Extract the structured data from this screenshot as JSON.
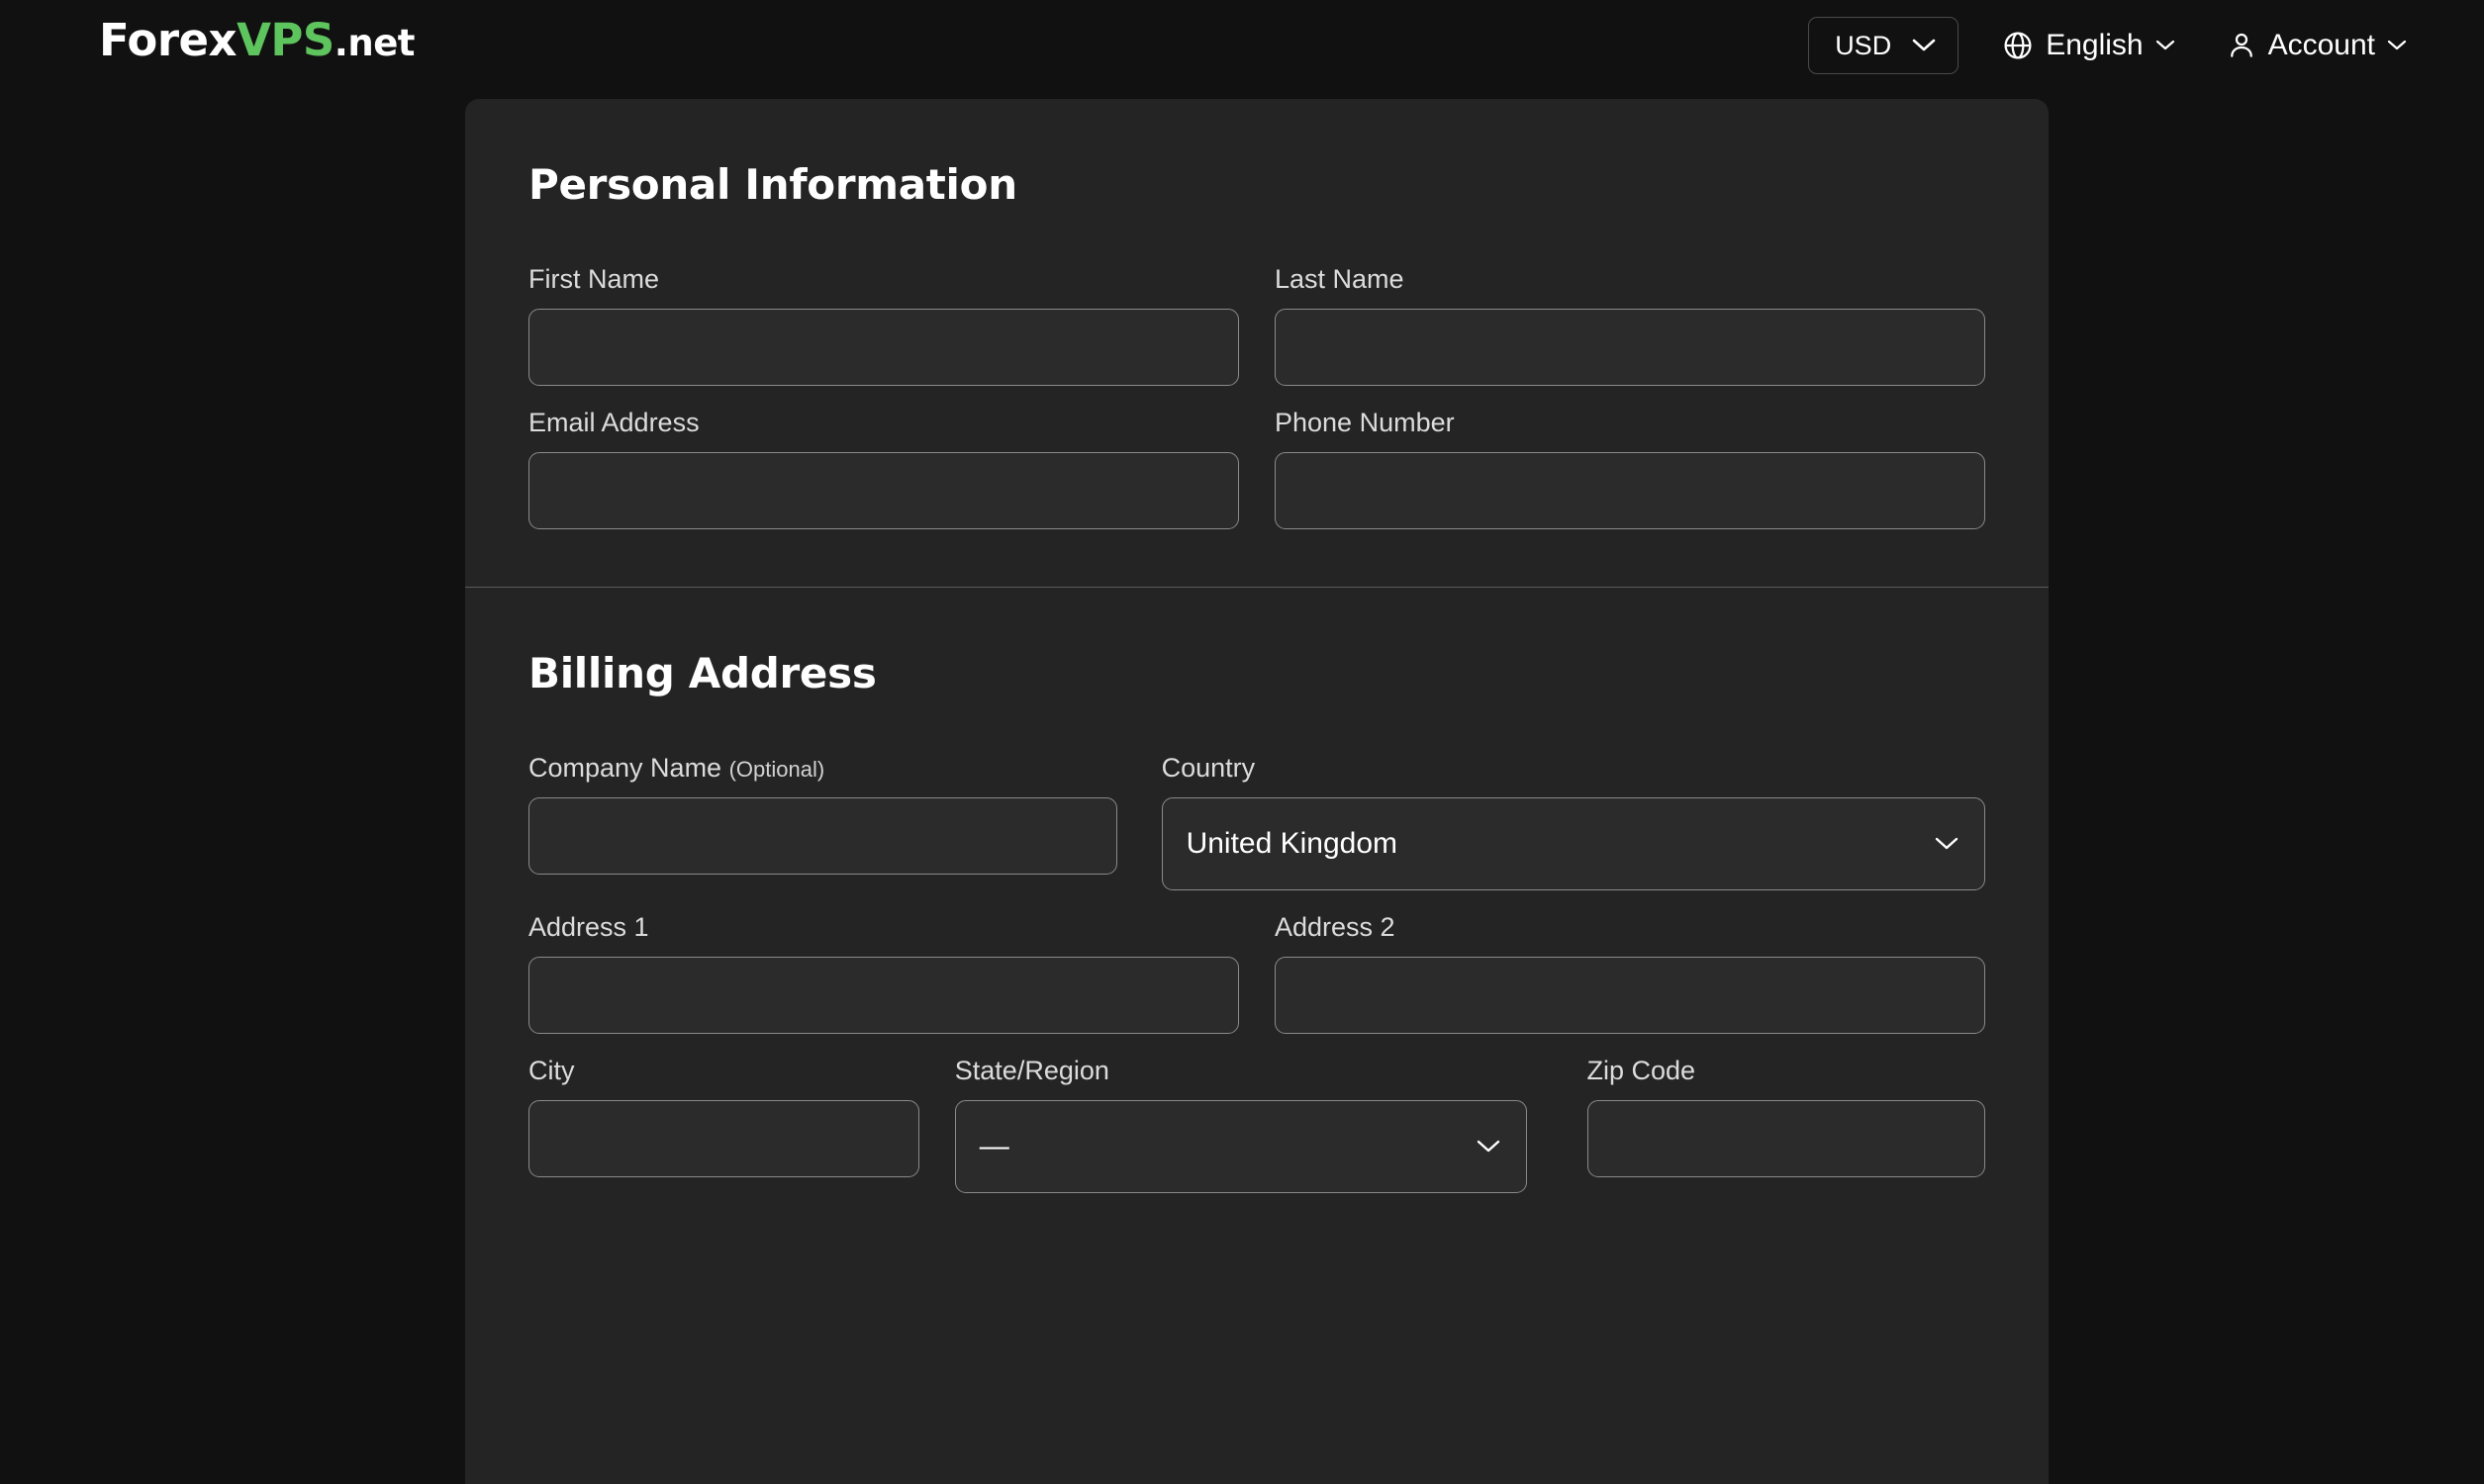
{
  "header": {
    "logo": {
      "part1": "Forex",
      "part2": "VPS",
      "part3": ".net",
      "accent_color": "#5ec45e"
    },
    "currency": {
      "value": "USD",
      "icon": "chevron-down-icon"
    },
    "language": {
      "label": "English",
      "icon": "globe-icon",
      "chevron": "chevron-down-icon"
    },
    "account": {
      "label": "Account",
      "icon": "user-icon",
      "chevron": "chevron-down-icon"
    }
  },
  "personal_information": {
    "title": "Personal Information",
    "fields": [
      {
        "label": "First Name",
        "value": "",
        "placeholder": ""
      },
      {
        "label": "Last Name",
        "value": "",
        "placeholder": ""
      },
      {
        "label": "Email Address",
        "value": "",
        "placeholder": ""
      },
      {
        "label": "Phone Number",
        "value": "",
        "placeholder": ""
      }
    ]
  },
  "billing_address": {
    "title": "Billing Address",
    "company": {
      "label": "Company Name",
      "optional_tag": "(Optional)",
      "value": "",
      "placeholder": ""
    },
    "country": {
      "label": "Country",
      "value": "United Kingdom"
    },
    "address1": {
      "label": "Address 1",
      "value": "",
      "placeholder": ""
    },
    "address2": {
      "label": "Address 2",
      "value": "",
      "placeholder": ""
    },
    "city": {
      "label": "City",
      "value": "",
      "placeholder": ""
    },
    "state": {
      "label": "State/Region",
      "value": "—"
    },
    "zip": {
      "label": "Zip Code",
      "value": "",
      "placeholder": ""
    }
  }
}
